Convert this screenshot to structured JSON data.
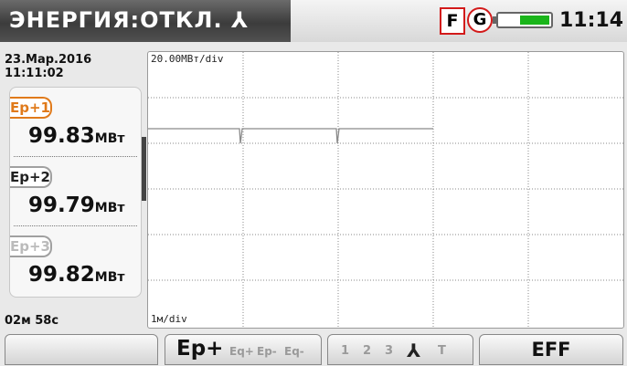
{
  "header": {
    "title": "ЭНЕРГИЯ:ОТКЛ. ⅄",
    "flag_f": "F",
    "flag_g": "G",
    "clock": "11:14",
    "battery_level": 0.6
  },
  "status": {
    "date": "23.Мар.2016",
    "time": "11:11:02",
    "timer": "02м 58с"
  },
  "signals": [
    {
      "label": "Ep+1",
      "value": "99.83",
      "unit": "МВт",
      "color": "#e07a1a"
    },
    {
      "label": "Ep+2",
      "value": "99.79",
      "unit": "МВт",
      "color": "#a0a0a0"
    },
    {
      "label": "Ep+3",
      "value": "99.82",
      "unit": "МВт",
      "color": "#a0a0a0"
    }
  ],
  "plot": {
    "y_scale": "20.00МВт/div",
    "x_scale": "1м/div"
  },
  "toolbar": {
    "btn1_label": "",
    "btn2_main": "Ep+",
    "btn2_opts": [
      "Eq+",
      "Ep-",
      "Eq-"
    ],
    "btn3_phases": [
      "1",
      "2",
      "3"
    ],
    "btn3_icon": "⅄",
    "btn3_t": "T",
    "btn4_label": "EFF"
  }
}
